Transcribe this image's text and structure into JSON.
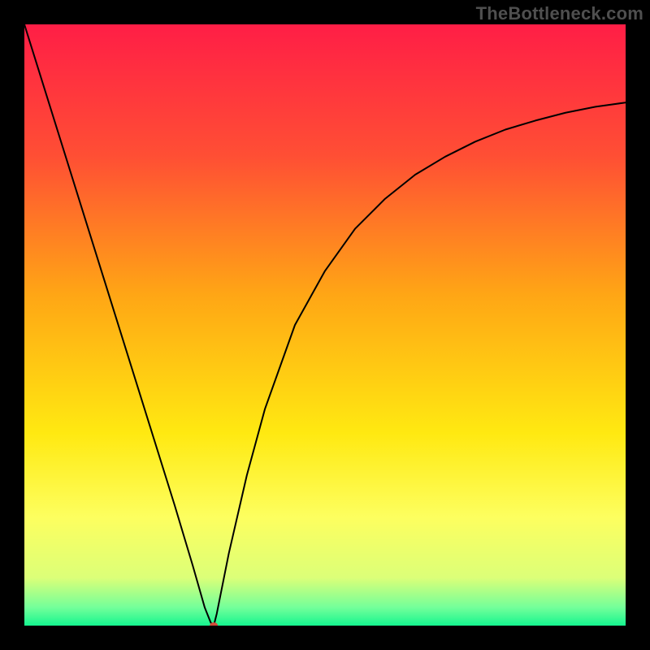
{
  "watermark": "TheBottleneck.com",
  "chart_data": {
    "type": "line",
    "title": "",
    "xlabel": "",
    "ylabel": "",
    "xlim": [
      0,
      100
    ],
    "ylim": [
      0,
      100
    ],
    "background_gradient": {
      "stops": [
        {
          "offset": 0.0,
          "color": "#ff1e46"
        },
        {
          "offset": 0.22,
          "color": "#ff4f34"
        },
        {
          "offset": 0.45,
          "color": "#ffa615"
        },
        {
          "offset": 0.68,
          "color": "#ffe911"
        },
        {
          "offset": 0.82,
          "color": "#fdff5f"
        },
        {
          "offset": 0.92,
          "color": "#dcff78"
        },
        {
          "offset": 0.97,
          "color": "#73ff9a"
        },
        {
          "offset": 1.0,
          "color": "#15f58f"
        }
      ]
    },
    "series": [
      {
        "name": "bottleneck-curve",
        "x": [
          0,
          5,
          10,
          15,
          20,
          25,
          28,
          30,
          31,
          31.5,
          32,
          34,
          37,
          40,
          45,
          50,
          55,
          60,
          65,
          70,
          75,
          80,
          85,
          90,
          95,
          100
        ],
        "y": [
          100,
          84,
          68,
          52,
          36,
          20,
          10,
          3,
          0.5,
          0,
          2,
          12,
          25,
          36,
          50,
          59,
          66,
          71,
          75,
          78,
          80.5,
          82.5,
          84,
          85.3,
          86.3,
          87
        ],
        "stroke": "#000000",
        "stroke_width": 2
      }
    ],
    "marker": {
      "name": "optimal-point",
      "x": 31.5,
      "y": 0,
      "rx": 5,
      "ry": 4,
      "fill": "#d24a3a"
    }
  }
}
